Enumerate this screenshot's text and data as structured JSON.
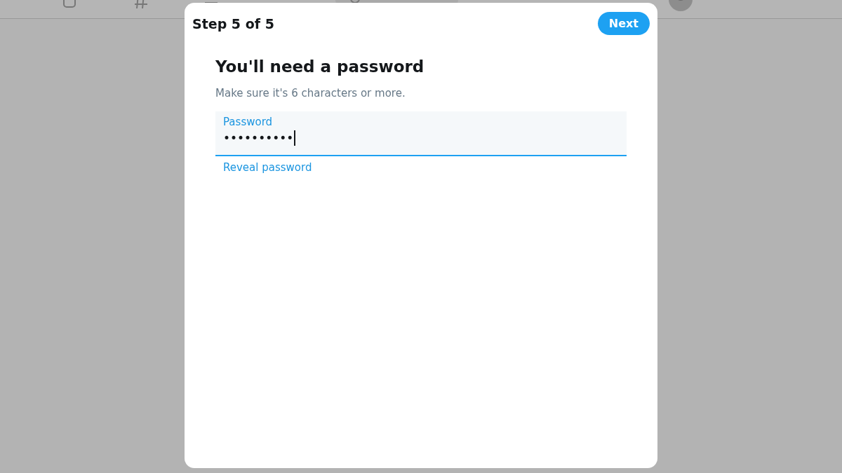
{
  "dialog": {
    "step": "Step 5 of 5",
    "next_button": "Next",
    "title": "You'll need a password",
    "hint": "Make sure it's 6 characters or more.",
    "field": {
      "label": "Password",
      "value": "••••••••••",
      "focused": true
    },
    "reveal_link": "Reveal password"
  }
}
